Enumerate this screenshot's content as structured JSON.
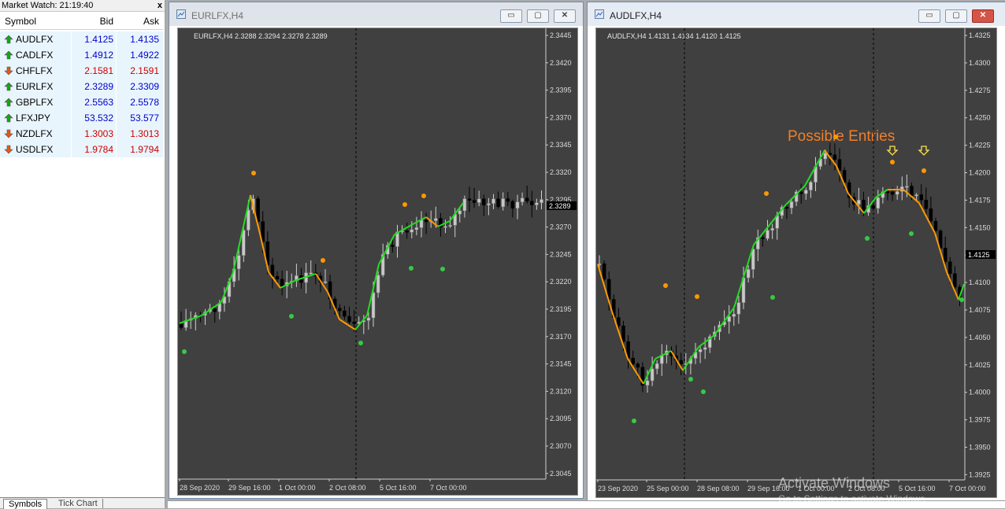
{
  "market_watch": {
    "title": "Market Watch: 21:19:40",
    "close_glyph": "x",
    "columns": {
      "symbol": "Symbol",
      "bid": "Bid",
      "ask": "Ask"
    },
    "rows": [
      {
        "symbol": "AUDLFX",
        "bid": "1.4125",
        "ask": "1.4135",
        "direction": "up"
      },
      {
        "symbol": "CADLFX",
        "bid": "1.4912",
        "ask": "1.4922",
        "direction": "up"
      },
      {
        "symbol": "CHFLFX",
        "bid": "2.1581",
        "ask": "2.1591",
        "direction": "down"
      },
      {
        "symbol": "EURLFX",
        "bid": "2.3289",
        "ask": "2.3309",
        "direction": "up"
      },
      {
        "symbol": "GBPLFX",
        "bid": "2.5563",
        "ask": "2.5578",
        "direction": "up"
      },
      {
        "symbol": "LFXJPY",
        "bid": "53.532",
        "ask": "53.577",
        "direction": "up"
      },
      {
        "symbol": "NZDLFX",
        "bid": "1.3003",
        "ask": "1.3013",
        "direction": "down"
      },
      {
        "symbol": "USDLFX",
        "bid": "1.9784",
        "ask": "1.9794",
        "direction": "down"
      }
    ],
    "tabs": {
      "symbols": "Symbols",
      "tick_chart": "Tick Chart"
    },
    "colors": {
      "up": "#0000cc",
      "down": "#cc0000",
      "up_icon": "#1aa31a",
      "down_icon": "#e05a1a"
    }
  },
  "eur_window": {
    "title": "EURLFX,H4",
    "info": "EURLFX,H4  2.3288 2.3294 2.3278 2.3289",
    "price_labels": [
      "2.3445",
      "2.3420",
      "2.3395",
      "2.3370",
      "2.3345",
      "2.3320",
      "2.3295",
      "2.3270",
      "2.3245",
      "2.3220",
      "2.3195",
      "2.3170",
      "2.3145",
      "2.3120",
      "2.3095",
      "2.3070",
      "2.3045"
    ],
    "current_price": "2.3289",
    "time_labels": [
      "28 Sep 2020",
      "29 Sep 16:00",
      "1 Oct 00:00",
      "2 Oct 08:00",
      "5 Oct 16:00",
      "7 Oct 00:00"
    ],
    "buttons": {
      "minimize": "▭",
      "maximize": "▢",
      "close": "✕"
    }
  },
  "aud_window": {
    "title": "AUDLFX,H4",
    "info": "AUDLFX,H4  1.4131 1.4134 1.4120 1.4125",
    "price_labels": [
      "1.4325",
      "1.4300",
      "1.4275",
      "1.4250",
      "1.4225",
      "1.4200",
      "1.4175",
      "1.4150",
      "1.4125",
      "1.4100",
      "1.4075",
      "1.4050",
      "1.4025",
      "1.4000",
      "1.3975",
      "1.3950",
      "1.3925"
    ],
    "current_price": "1.4125",
    "time_labels": [
      "23 Sep 2020",
      "25 Sep 00:00",
      "28 Sep 08:00",
      "29 Sep 16:00",
      "1 Oct 00:00",
      "2 Oct 08:00",
      "5 Oct 16:00",
      "7 Oct 00:00"
    ],
    "annotation": "Possible Entries",
    "buttons": {
      "minimize": "▭",
      "maximize": "▢",
      "close": "✕"
    }
  },
  "chart_colors": {
    "background": "#404040",
    "bull": "#c8c8c8",
    "bear": "#000000",
    "ma_up": "#22dd22",
    "ma_down": "#ff9900",
    "dot_up": "#33cc44",
    "dot_down": "#ff9900",
    "annotation": "#f07f2a",
    "arrow": "#ffe14a"
  },
  "watermark": {
    "line1": "Activate Windows",
    "line2": "Go to Settings to activate Windows."
  }
}
